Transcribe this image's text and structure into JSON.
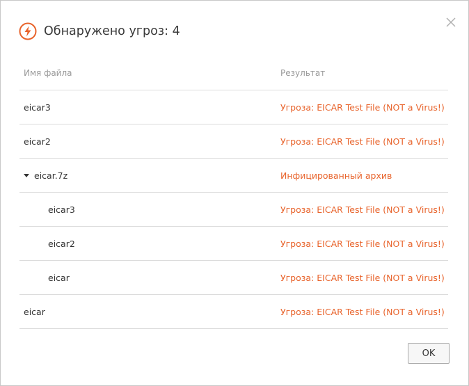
{
  "dialog": {
    "title": "Обнаружено угроз: 4",
    "header_icon": "lightning-bolt-icon",
    "accent_color": "#e8632b",
    "close_icon": "close-icon"
  },
  "table": {
    "columns": {
      "name": "Имя файла",
      "result": "Результат"
    },
    "rows": [
      {
        "name": "eicar3",
        "result": "Угроза: EICAR Test File (NOT a Virus!)",
        "level": 0,
        "expandable": false
      },
      {
        "name": "eicar2",
        "result": "Угроза: EICAR Test File (NOT a Virus!)",
        "level": 0,
        "expandable": false
      },
      {
        "name": "eicar.7z",
        "result": "Инфицированный архив",
        "level": 0,
        "expandable": true,
        "expanded": true
      },
      {
        "name": "eicar3",
        "result": "Угроза: EICAR Test File (NOT a Virus!)",
        "level": 1,
        "expandable": false
      },
      {
        "name": "eicar2",
        "result": "Угроза: EICAR Test File (NOT a Virus!)",
        "level": 1,
        "expandable": false
      },
      {
        "name": "eicar",
        "result": "Угроза: EICAR Test File (NOT a Virus!)",
        "level": 1,
        "expandable": false
      },
      {
        "name": "eicar",
        "result": "Угроза: EICAR Test File (NOT a Virus!)",
        "level": 0,
        "expandable": false
      }
    ]
  },
  "footer": {
    "ok_label": "OK"
  }
}
